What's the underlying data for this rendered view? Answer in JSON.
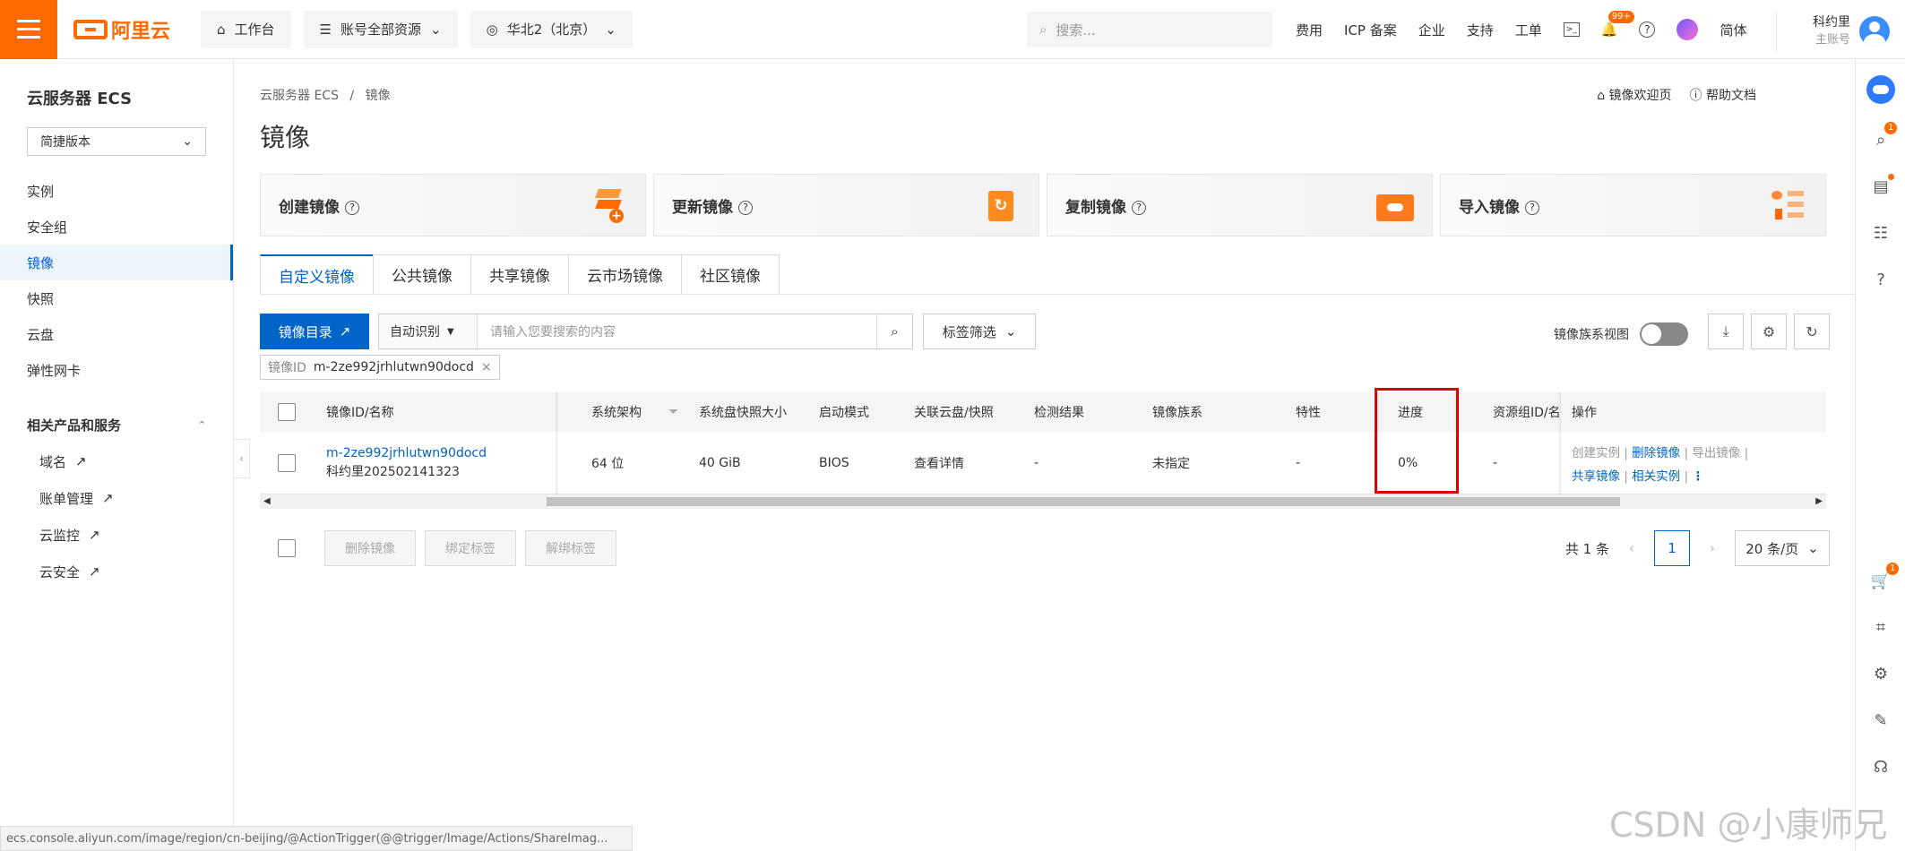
{
  "topbar": {
    "logo_text": "阿里云",
    "workbench": "工作台",
    "account_resources": "账号全部资源",
    "region": "华北2（北京）",
    "search_placeholder": "搜索...",
    "links": [
      "费用",
      "ICP 备案",
      "企业",
      "支持",
      "工单"
    ],
    "notify_badge": "99+",
    "lang": "简体",
    "user_name": "科约里",
    "user_role": "主账号"
  },
  "sidebar": {
    "title": "云服务器 ECS",
    "version_select": "简捷版本",
    "items": [
      "实例",
      "安全组",
      "镜像",
      "快照",
      "云盘",
      "弹性网卡"
    ],
    "active_item": "镜像",
    "group_title": "相关产品和服务",
    "sub_items": [
      "域名",
      "账单管理",
      "云监控",
      "云安全"
    ]
  },
  "main": {
    "breadcrumb": [
      "云服务器 ECS",
      "镜像"
    ],
    "title": "镜像",
    "help_links": [
      "镜像欢迎页",
      "帮助文档"
    ],
    "cards": [
      "创建镜像",
      "更新镜像",
      "复制镜像",
      "导入镜像"
    ],
    "tabs": [
      "自定义镜像",
      "公共镜像",
      "共享镜像",
      "云市场镜像",
      "社区镜像"
    ],
    "active_tab": "自定义镜像",
    "catalog_button": "镜像目录",
    "search_mode": "自动识别",
    "search_placeholder": "请输入您要搜索的内容",
    "tag_filter": "标签筛选",
    "family_view_label": "镜像族系视图",
    "filter_chip": {
      "key": "镜像ID",
      "value": "m-2ze992jrhlutwn90docd"
    }
  },
  "table": {
    "columns": [
      "镜像ID/名称",
      "系统架构",
      "系统盘快照大小",
      "启动模式",
      "关联云盘/快照",
      "检测结果",
      "镜像族系",
      "特性",
      "进度",
      "资源组ID/名",
      "操作"
    ],
    "rows": [
      {
        "id": "m-2ze992jrhlutwn90docd",
        "name": "科约里202502141323",
        "arch": "64 位",
        "disk_size": "40 GiB",
        "boot_mode": "BIOS",
        "related": "查看详情",
        "check": "-",
        "family": "未指定",
        "feature": "-",
        "progress": "0%",
        "resource_group": "-",
        "actions_row1": [
          "创建实例",
          "删除镜像",
          "导出镜像"
        ],
        "actions_row2": [
          "共享镜像",
          "相关实例"
        ]
      }
    ]
  },
  "bulk_actions": [
    "删除镜像",
    "绑定标签",
    "解绑标签"
  ],
  "pagination": {
    "total": "共 1 条",
    "current": "1",
    "page_size": "20 条/页"
  },
  "status_url": "ecs.console.aliyun.com/image/region/cn-beijing/@ActionTrigger(@@trigger/Image/Actions/ShareImag...",
  "watermark": "CSDN @小康师兄",
  "colors": {
    "brand_orange": "#ff6a00",
    "primary_blue": "#0064c8",
    "highlight_red": "#e00000"
  }
}
